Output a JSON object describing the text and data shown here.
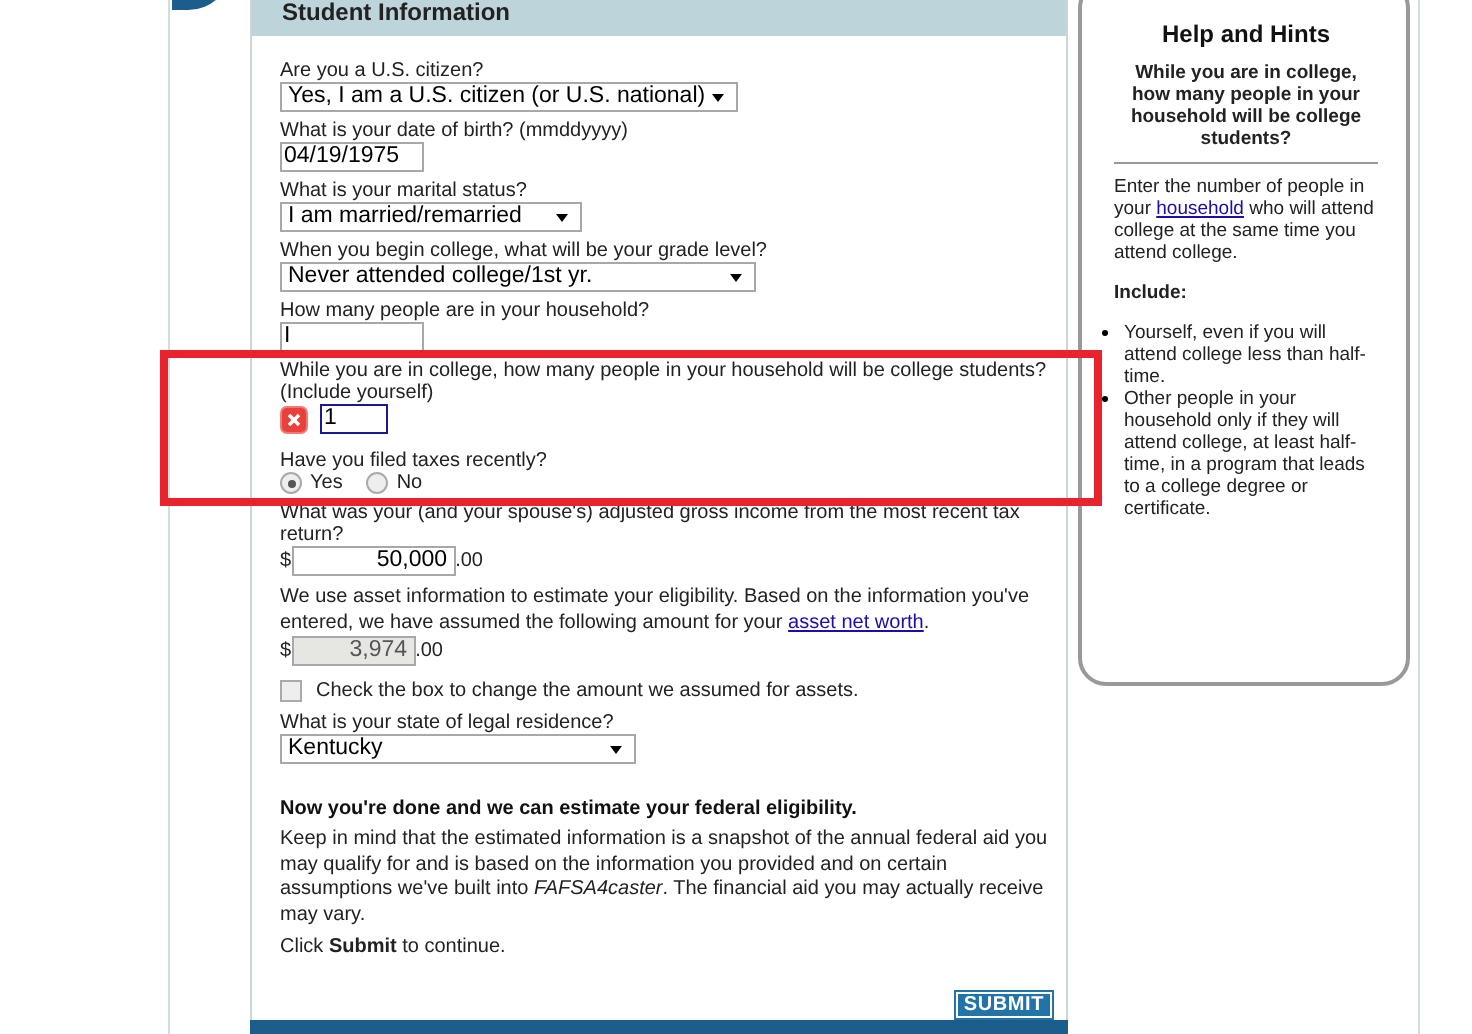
{
  "header": {
    "title": "Student Information"
  },
  "fields": [
    {
      "kind": "select",
      "label": "Are you a U.S. citizen?",
      "value": "Yes, I am a U.S. citizen (or U.S. national)"
    },
    {
      "kind": "text",
      "label": "What is your date of birth? (mmddyyyy)",
      "value": "04/19/1975"
    },
    {
      "kind": "select",
      "label": "What is your marital status?",
      "value": "I am married/remarried"
    },
    {
      "kind": "select",
      "label": "When you begin college, what will be your grade level?",
      "value": "Never attended college/1st yr."
    },
    {
      "kind": "text",
      "label": "How many people are in your household?",
      "value": "I"
    },
    {
      "kind": "counted",
      "label": "While you are in college, how many people in your household will be college students?",
      "note": "(Include yourself)",
      "value": "1",
      "error": true
    },
    {
      "kind": "radio",
      "label": "Have you filed taxes recently?",
      "options": [
        {
          "label": "Yes",
          "selected": true
        },
        {
          "label": "No",
          "selected": false
        }
      ]
    },
    {
      "kind": "money",
      "label": "What was your (and your spouse's) adjusted gross income from the most recent tax",
      "label2": "return?",
      "currency": "$",
      "value": "50,000",
      "cents": ".00",
      "disabled": false
    },
    {
      "kind": "money",
      "text": "We use asset information to estimate your eligibility. Based on the information you've entered, we have assumed the following amount for your ",
      "link": "asset net worth",
      "after": ".",
      "currency": "$",
      "value": "3,974",
      "cents": ".00",
      "disabled": true
    },
    {
      "kind": "checkbox",
      "label": "Check the box to change the amount we assumed for assets.",
      "checked": false
    },
    {
      "kind": "select",
      "label": "What is your state of legal residence?",
      "value": "Kentucky"
    }
  ],
  "summary": {
    "heading": "Now you're done and we can estimate your federal eligibility.",
    "text": "Keep in mind that the estimated information is a snapshot of the annual federal aid you may qualify for and is based on the information you provided and on certain assumptions we've built into *FAFSA4caster*. The financial aid you may actually receive may vary.",
    "prompt": "Click **Submit** to continue."
  },
  "submit": "SUBMIT",
  "help": {
    "title": "Help and Hints",
    "question": "While you are in college, how many people in your household will be college students?",
    "before": "Enter the number of people in your ",
    "link": "household",
    "after": " who will attend college at the same time you attend college.",
    "include": "Include:",
    "bullets": [
      "Yourself, even if you will attend college less than half-time.",
      "Other people in your household only if they will attend college, at least half-time, in a program that leads to a college degree or certificate."
    ]
  }
}
